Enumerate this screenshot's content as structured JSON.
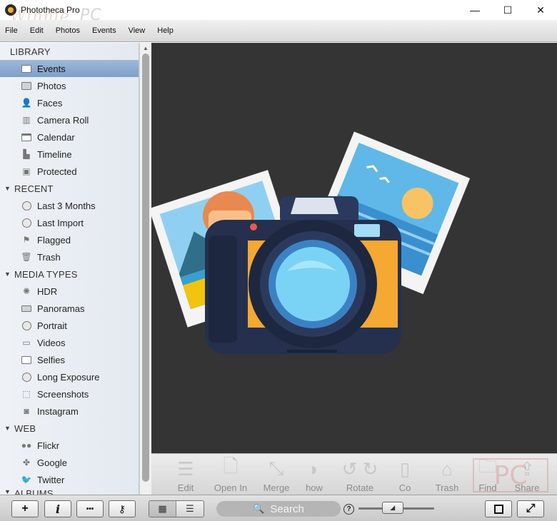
{
  "window": {
    "title": "Phototheca Pro",
    "watermark": "Winnie PC",
    "controls": {
      "minimize": "—",
      "maximize": "☐",
      "close": "✕"
    }
  },
  "menu": [
    "File",
    "Edit",
    "Photos",
    "Events",
    "View",
    "Help"
  ],
  "sidebar": {
    "library": {
      "heading": "LIBRARY",
      "items": [
        {
          "label": "Events",
          "icon": "events-icon"
        },
        {
          "label": "Photos",
          "icon": "photos-icon"
        },
        {
          "label": "Faces",
          "icon": "faces-icon"
        },
        {
          "label": "Camera Roll",
          "icon": "camera-roll-icon"
        },
        {
          "label": "Calendar",
          "icon": "calendar-icon"
        },
        {
          "label": "Timeline",
          "icon": "timeline-icon"
        },
        {
          "label": "Protected",
          "icon": "protected-icon"
        }
      ]
    },
    "recent": {
      "heading": "RECENT",
      "items": [
        {
          "label": "Last 3 Months",
          "icon": "clock-icon"
        },
        {
          "label": "Last Import",
          "icon": "clock-icon"
        },
        {
          "label": "Flagged",
          "icon": "flag-icon"
        },
        {
          "label": "Trash",
          "icon": "trash-icon"
        }
      ]
    },
    "media_types": {
      "heading": "MEDIA TYPES",
      "items": [
        {
          "label": "HDR",
          "icon": "hdr-icon"
        },
        {
          "label": "Panoramas",
          "icon": "panorama-icon"
        },
        {
          "label": "Portrait",
          "icon": "portrait-icon"
        },
        {
          "label": "Videos",
          "icon": "video-icon"
        },
        {
          "label": "Selfies",
          "icon": "selfie-icon"
        },
        {
          "label": "Long Exposure",
          "icon": "long-exposure-icon"
        },
        {
          "label": "Screenshots",
          "icon": "screenshot-icon"
        },
        {
          "label": "Instagram",
          "icon": "instagram-icon"
        }
      ]
    },
    "web": {
      "heading": "WEB",
      "items": [
        {
          "label": "Flickr",
          "icon": "flickr-icon"
        },
        {
          "label": "Google",
          "icon": "google-icon"
        },
        {
          "label": "Twitter",
          "icon": "twitter-icon"
        }
      ]
    },
    "albums_heading": "ALBUMS",
    "selected": "Events"
  },
  "toolbar": {
    "edit": "Edit",
    "open_in": "Open In",
    "merge": "Merge",
    "slideshow": "how",
    "rotate": "Rotate",
    "copy": "Co",
    "trash": "Trash",
    "find": "Find",
    "share": "Share"
  },
  "statusbar": {
    "add": "+",
    "info": "i",
    "more": "•••",
    "key": "⚷",
    "view_grid": "▦",
    "view_list": "☰",
    "search_label": "Search",
    "help": "?",
    "fullscreen": "⤢",
    "slider_value": 0.45
  },
  "colors": {
    "selection": "#8eaad0",
    "viewer_bg": "#343434",
    "camera_body": "#24304d",
    "camera_accent": "#f5a832",
    "lens": "#7ad3f5"
  }
}
